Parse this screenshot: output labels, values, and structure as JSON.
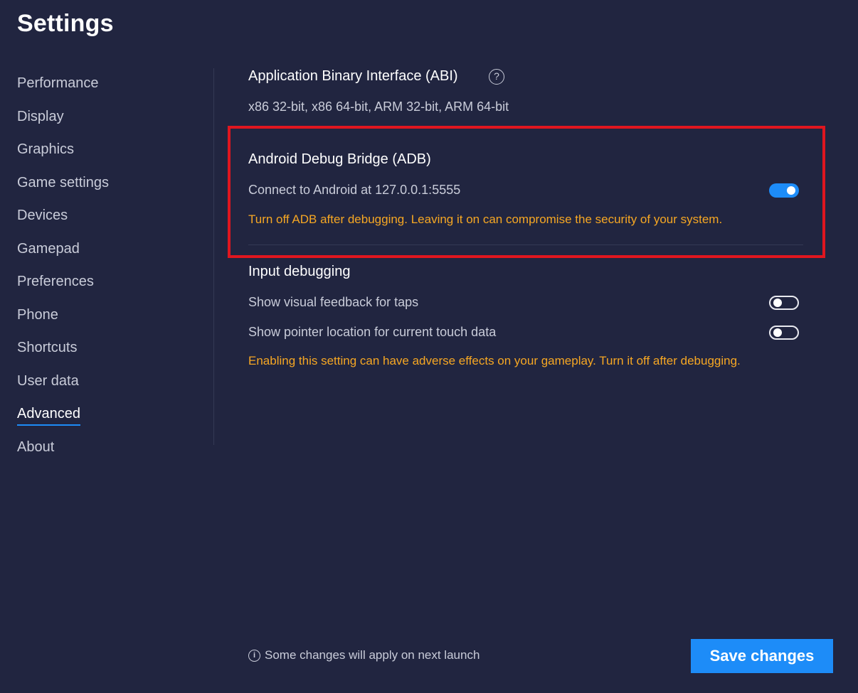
{
  "page": {
    "title": "Settings"
  },
  "sidebar": {
    "items": [
      {
        "label": "Performance"
      },
      {
        "label": "Display"
      },
      {
        "label": "Graphics"
      },
      {
        "label": "Game settings"
      },
      {
        "label": "Devices"
      },
      {
        "label": "Gamepad"
      },
      {
        "label": "Preferences"
      },
      {
        "label": "Phone"
      },
      {
        "label": "Shortcuts"
      },
      {
        "label": "User data"
      },
      {
        "label": "Advanced"
      },
      {
        "label": "About"
      }
    ],
    "active": "Advanced"
  },
  "abi": {
    "title": "Application Binary Interface (ABI)",
    "help_icon": "?",
    "value": "x86 32-bit, x86 64-bit, ARM 32-bit, ARM 64-bit"
  },
  "adb": {
    "title": "Android Debug Bridge (ADB)",
    "connect_label": "Connect to Android at 127.0.0.1:5555",
    "toggle_on": true,
    "warning": "Turn off ADB after debugging. Leaving it on can compromise the security of your system."
  },
  "input_debugging": {
    "title": "Input debugging",
    "taps_label": "Show visual feedback for taps",
    "taps_on": false,
    "pointer_label": "Show pointer location for current touch data",
    "pointer_on": false,
    "warning": "Enabling this setting can have adverse effects on your gameplay. Turn it off after debugging."
  },
  "footer": {
    "info_icon": "i",
    "note": "Some changes will apply on next launch",
    "save_label": "Save changes"
  },
  "colors": {
    "background": "#212540",
    "accent": "#1d8cf8",
    "warning": "#f6a723",
    "highlight": "#e0161f"
  }
}
